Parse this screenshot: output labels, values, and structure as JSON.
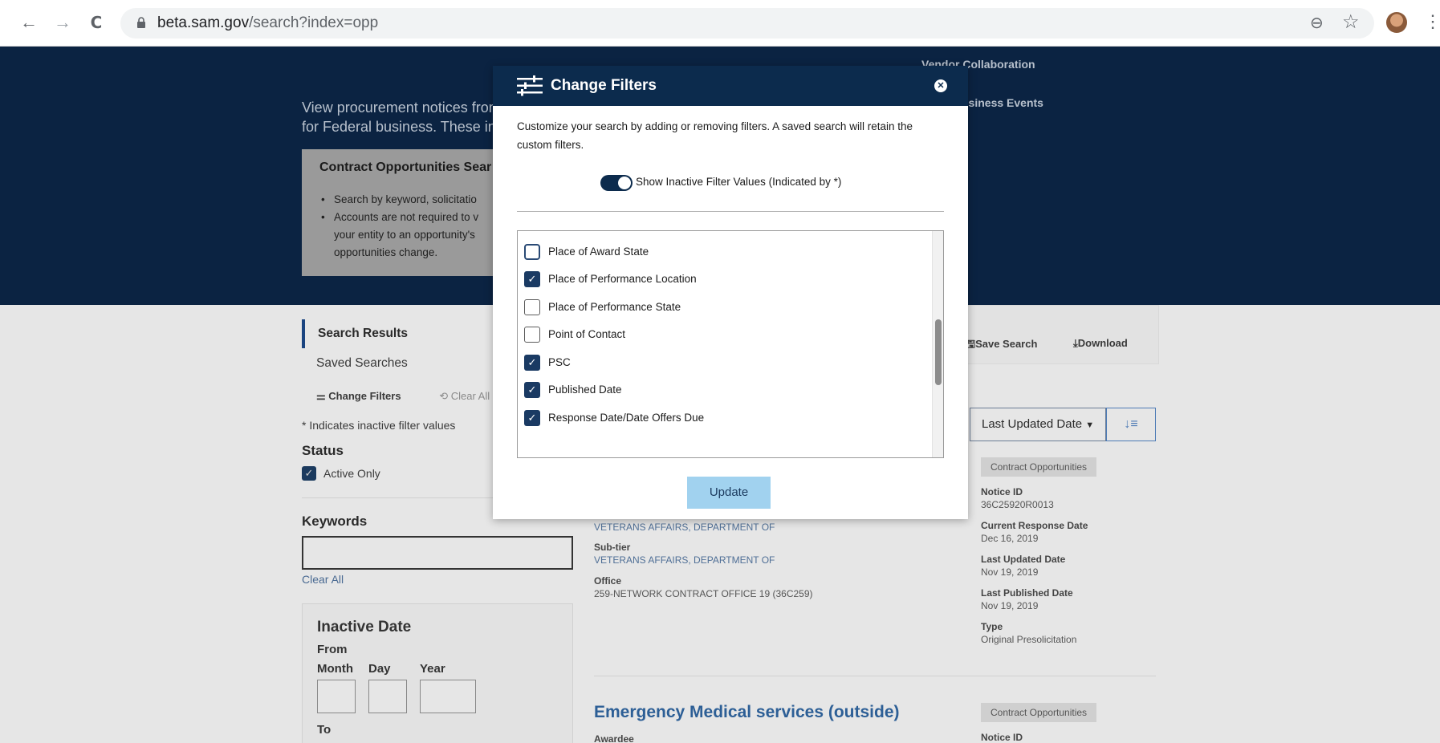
{
  "browser": {
    "back_icon": "←",
    "forward_icon": "→",
    "reload_icon": "C",
    "url_host": "beta.sam.gov",
    "url_path": "/search?index=opp",
    "zoom_icon": "⊖",
    "star_icon": "☆",
    "menu_icon": "⋮"
  },
  "hero": {
    "text": "View procurement notices from Federal contracting offices to find opportunities to bid for Federal business. These inc notices and sole source notice account.",
    "links": [
      "Vendor Collaboration",
      "usiness Events"
    ]
  },
  "info_box": {
    "title": "Contract Opportunities Sear",
    "bullets": [
      "Search by keyword, solicitatio",
      "Accounts are not required to v",
      "your entity to an opportunity's",
      "opportunities change."
    ]
  },
  "sidebar": {
    "tabs": [
      "Search Results",
      "Saved Searches"
    ],
    "change_filters": "Change Filters",
    "clear_all_top": "Clear All",
    "inactive_note": "* Indicates inactive filter values",
    "status_heading": "Status",
    "active_only": "Active Only",
    "keywords_heading": "Keywords",
    "clear_all": "Clear All",
    "inactive_date": {
      "title": "Inactive Date",
      "from": "From",
      "month": "Month",
      "day": "Day",
      "year": "Year",
      "to": "To"
    }
  },
  "toolbar": {
    "save_search": "Save Search",
    "download": "Download",
    "sort_value": "Last Updated Date",
    "sort_dir_icon": "↓≡"
  },
  "results": {
    "item1": {
      "tag": "Contract Opportunities",
      "dept_value": "VETERANS AFFAIRS, DEPARTMENT OF",
      "subtier_label": "Sub-tier",
      "subtier_value": "VETERANS AFFAIRS, DEPARTMENT OF",
      "office_label": "Office",
      "office_value": "259-NETWORK CONTRACT OFFICE 19 (36C259)",
      "notice_id_label": "Notice ID",
      "notice_id": "36C25920R0013",
      "resp_label": "Current Response Date",
      "resp_value": "Dec 16, 2019",
      "updated_label": "Last Updated Date",
      "updated_value": "Nov 19, 2019",
      "published_label": "Last Published Date",
      "published_value": "Nov 19, 2019",
      "type_label": "Type",
      "type_value": "Original Presolicitation"
    },
    "item2": {
      "title": "Emergency Medical services (outside)",
      "tag": "Contract Opportunities",
      "awardee_label": "Awardee",
      "notice_id_label": "Notice ID"
    }
  },
  "modal": {
    "title": "Change Filters",
    "close_icon": "✕",
    "description": "Customize your search by adding or removing filters. A saved search will retain the custom filters.",
    "toggle_on": true,
    "toggle_label": "Show Inactive Filter Values (Indicated by *)",
    "filters": [
      {
        "label": "Place of Award State",
        "checked": false
      },
      {
        "label": "Place of Performance Location",
        "checked": true
      },
      {
        "label": "Place of Performance State",
        "checked": false
      },
      {
        "label": "Point of Contact",
        "checked": false
      },
      {
        "label": "PSC",
        "checked": true
      },
      {
        "label": "Published Date",
        "checked": true
      },
      {
        "label": "Response Date/Date Offers Due",
        "checked": true
      }
    ],
    "scroll_position": 0.55,
    "update_label": "Update"
  }
}
